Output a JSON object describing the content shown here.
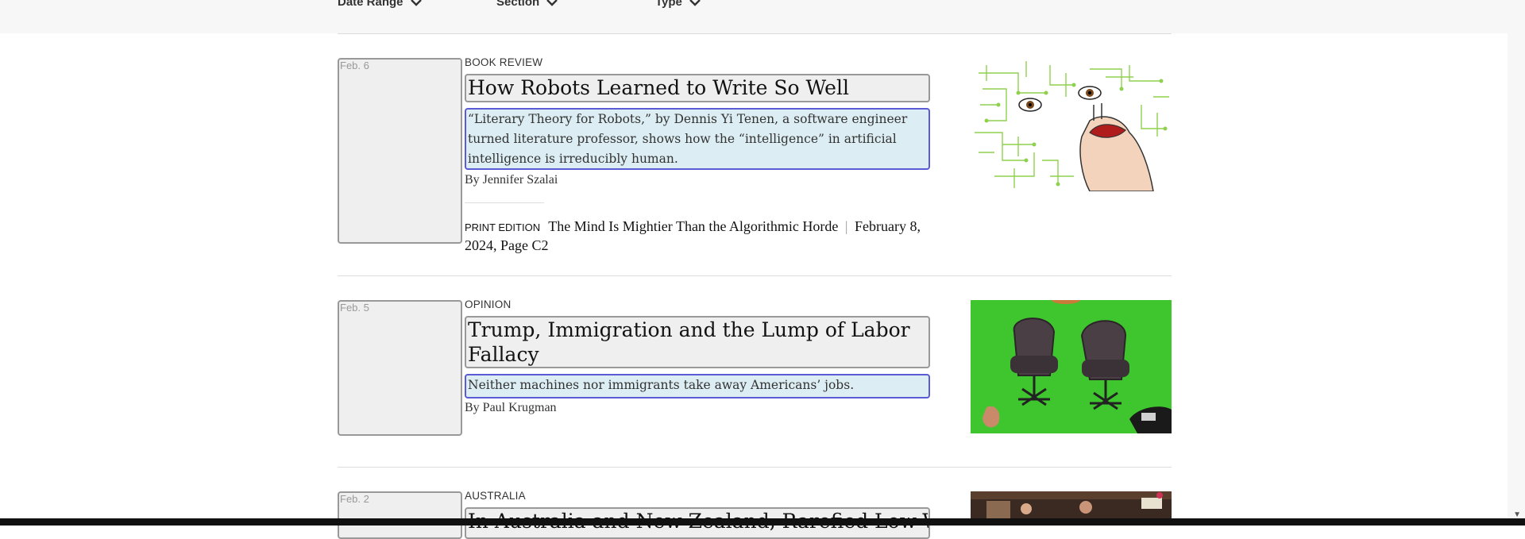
{
  "filters": [
    {
      "label": "Date Range"
    },
    {
      "label": "Section"
    },
    {
      "label": "Type"
    }
  ],
  "results": [
    {
      "date": "Feb. 6",
      "kicker": "BOOK REVIEW",
      "headline": "How Robots Learned to Write So Well",
      "summary": "“Literary Theory for Robots,” by Dennis Yi Tenen, a software engineer turned literature professor, shows how the “intelligence” in artificial intelligence is irreducibly human.",
      "byline": "By Jennifer Szalai",
      "print_label": "PRINT EDITION",
      "print_title": "The Mind Is Mightier Than the Algorithmic Horde",
      "print_sep": "|",
      "print_date": "February 8, 2024, Page C2"
    },
    {
      "date": "Feb. 5",
      "kicker": "OPINION",
      "headline": "Trump, Immigration and the Lump of Labor Fallacy",
      "summary": "Neither machines nor immigrants take away Americans’ jobs.",
      "byline": "By Paul Krugman"
    },
    {
      "date": "Feb. 2",
      "kicker": "AUSTRALIA",
      "headline": "In Australia and New Zealand, Rarefied Low-W"
    }
  ]
}
